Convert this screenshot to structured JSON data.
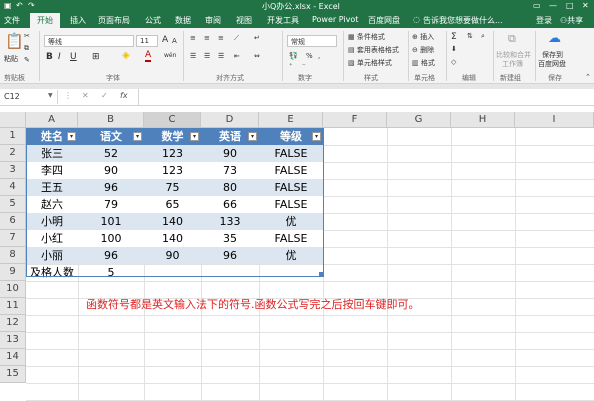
{
  "title": {
    "text": "小Q办公.xlsx - Excel",
    "login": "登录",
    "share": "共享"
  },
  "tabs": [
    "文件",
    "开始",
    "插入",
    "页面布局",
    "公式",
    "数据",
    "审阅",
    "视图",
    "开发工具",
    "Power Pivot",
    "百度网盘",
    "告诉我您想要做什么..."
  ],
  "ribbon": {
    "paste": "粘贴",
    "font_name": "等线",
    "font_size": "11",
    "bold": "B",
    "italic": "I",
    "underline": "U",
    "grow": "A",
    "shrink": "A",
    "font_color_glyph": "A",
    "wen": "wén",
    "number_format": "常规",
    "percent": "%",
    "comma": ",",
    "conditional": "条件格式",
    "as_table": "套用表格格式",
    "cell_style": "单元格样式",
    "insert": "插入",
    "delete": "删除",
    "format": "格式",
    "merge": "比较和合并",
    "merge2": "工作簿",
    "save_baidu": "保存到",
    "save_baidu2": "百度网盘",
    "groups": {
      "clipboard": "剪贴板",
      "font": "字体",
      "alignment": "对齐方式",
      "number": "数字",
      "styles": "样式",
      "cells": "单元格",
      "editing": "编辑",
      "new_group": "新建组",
      "save": "保存"
    }
  },
  "formula_bar": {
    "name_box": "C12",
    "fx": "fx",
    "cancel": "✕",
    "enter": "✓",
    "content": ""
  },
  "columns": [
    "A",
    "B",
    "C",
    "D",
    "E",
    "F",
    "G",
    "H",
    "I"
  ],
  "rows": [
    "1",
    "2",
    "3",
    "4",
    "5",
    "6",
    "7",
    "8",
    "9",
    "10",
    "11",
    "12",
    "13",
    "14",
    "15"
  ],
  "table": {
    "headers": [
      "姓名",
      "语文",
      "数学",
      "英语",
      "等级"
    ],
    "data": [
      [
        "张三",
        "52",
        "123",
        "90",
        "FALSE"
      ],
      [
        "李四",
        "90",
        "123",
        "73",
        "FALSE"
      ],
      [
        "王五",
        "96",
        "75",
        "80",
        "FALSE"
      ],
      [
        "赵六",
        "79",
        "65",
        "66",
        "FALSE"
      ],
      [
        "小明",
        "101",
        "140",
        "133",
        "优"
      ],
      [
        "小红",
        "100",
        "140",
        "35",
        "FALSE"
      ],
      [
        "小丽",
        "96",
        "90",
        "96",
        "优"
      ]
    ],
    "row9": [
      "及格人数",
      "5"
    ]
  },
  "note": "函数符号都是英文输入法下的符号.函数公式写完之后按回车键即可。",
  "colors": {
    "excel_green": "#217346",
    "table_header": "#4f81bd",
    "band": "#dce6f1",
    "note_red": "#e02020"
  }
}
